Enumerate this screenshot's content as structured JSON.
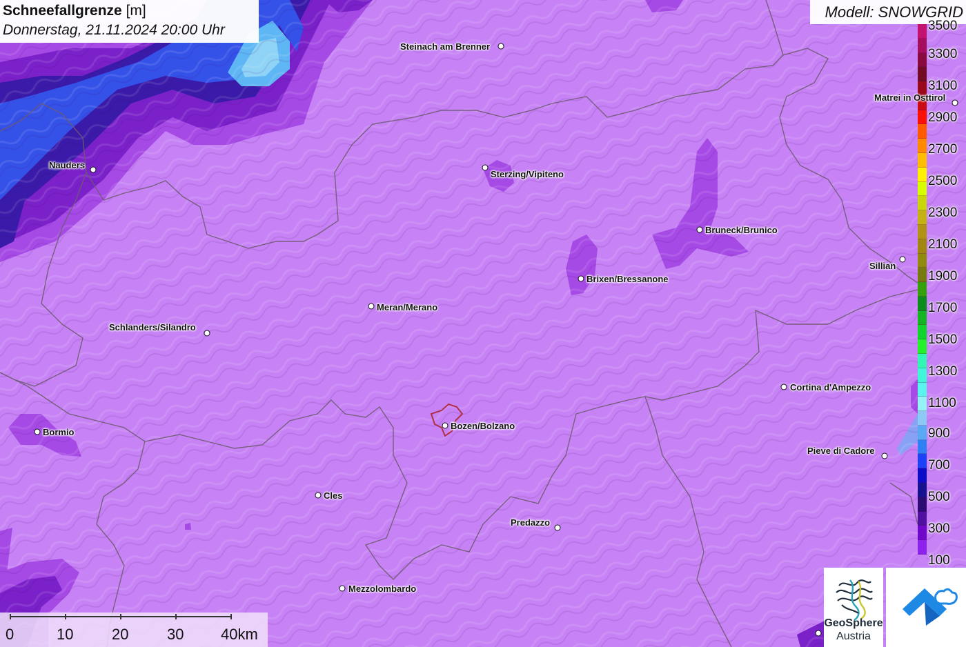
{
  "title": {
    "main": "Schneefallgrenze",
    "unit": "[m]",
    "datetime": "Donnerstag, 21.11.2024 20:00 Uhr"
  },
  "model": "Modell: SNOWGRID",
  "legend": {
    "labels": [
      "3500",
      "3300",
      "3100",
      "2900",
      "2700",
      "2500",
      "2300",
      "2100",
      "1900",
      "1700",
      "1500",
      "1300",
      "1100",
      "900",
      "700",
      "500",
      "300",
      "100"
    ],
    "colors": [
      "#c2116f",
      "#a50e5c",
      "#8a0a40",
      "#720c24",
      "#99091b",
      "#cc0a12",
      "#fa1007",
      "#ff5a00",
      "#ff8a00",
      "#ffbd00",
      "#fff000",
      "#d7ff00",
      "#c9d60b",
      "#c3b211",
      "#b19212",
      "#a08710",
      "#918a0c",
      "#777b0e",
      "#35a00a",
      "#0c8c1b",
      "#14b422",
      "#10d42b",
      "#24f02b",
      "#32f6b3",
      "#3ff6d8",
      "#59f5ef",
      "#95f2f5",
      "#8ec9f5",
      "#5aa9f5",
      "#2f7ff5",
      "#1d41f6",
      "#0b0cc8",
      "#15118f",
      "#2d0b74",
      "#51109f",
      "#6f08cb",
      "#8c22eb",
      "#c783f5"
    ],
    "icon": "colorbar-icon"
  },
  "cities": [
    {
      "name": "Steinach am Brenner"
    },
    {
      "name": "Matrei in Osttirol"
    },
    {
      "name": "Nauders"
    },
    {
      "name": "Sterzing/Vipiteno"
    },
    {
      "name": "Bruneck/Brunico"
    },
    {
      "name": "Sillian"
    },
    {
      "name": "Brixen/Bressanone"
    },
    {
      "name": "Meran/Merano"
    },
    {
      "name": "Schlanders/Silandro"
    },
    {
      "name": "Cortina d'Ampezzo"
    },
    {
      "name": "Bozen/Bolzano"
    },
    {
      "name": "Bormio"
    },
    {
      "name": "Pieve di Cadore"
    },
    {
      "name": "Cles"
    },
    {
      "name": "Predazzo"
    },
    {
      "name": "Mezzolombardo"
    }
  ],
  "scale": {
    "labels": [
      "0",
      "10",
      "20",
      "30",
      "40km"
    ]
  },
  "logos": {
    "geosphere_line1": "GeoSphere",
    "geosphere_line2": "Austria",
    "geosphere_icon": "geosphere-logo-icon",
    "brand_icon": "upload-arrow-logo-icon"
  },
  "colors": {
    "base": "#c783f5",
    "mid_purple": "#a64ae6",
    "deep_purple": "#7b21c9",
    "dark": "#3a1aa8",
    "blue": "#3451e8",
    "light_blue": "#5fb6f4",
    "border": "#6e5a72"
  }
}
